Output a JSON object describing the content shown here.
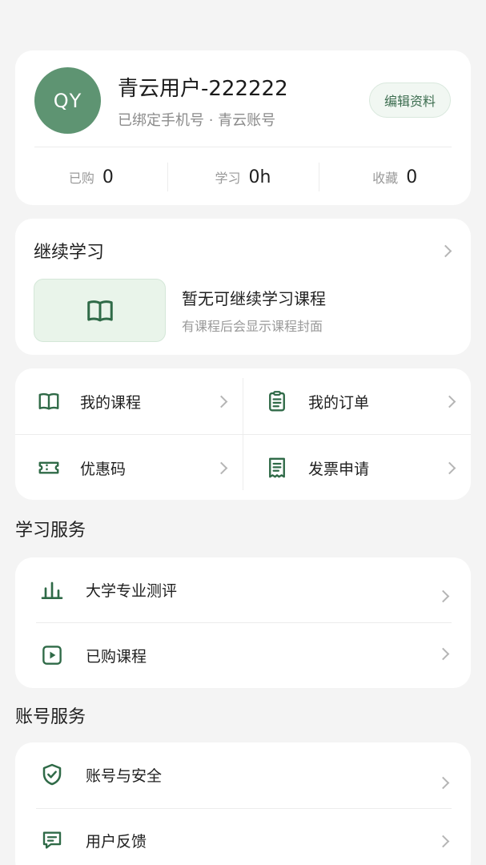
{
  "profile": {
    "avatar_initials": "QY",
    "name": "青云用户-222222",
    "subtitle": "已绑定手机号 · 青云账号",
    "edit_label": "编辑资料",
    "stats": [
      {
        "label": "已购",
        "value": "0"
      },
      {
        "label": "学习",
        "value": "0h"
      },
      {
        "label": "收藏",
        "value": "0"
      }
    ]
  },
  "continue_learning": {
    "title": "继续学习",
    "empty_title": "暂无可继续学习课程",
    "empty_subtitle": "有课程后会显示课程封面",
    "thumb_icon": "open-book-icon"
  },
  "quick_actions": [
    {
      "label": "我的课程",
      "icon": "open-book-icon"
    },
    {
      "label": "我的订单",
      "icon": "clipboard-icon"
    },
    {
      "label": "优惠码",
      "icon": "coupon-ticket-icon"
    },
    {
      "label": "发票申请",
      "icon": "receipt-icon"
    }
  ],
  "study_services": {
    "title": "学习服务",
    "items": [
      {
        "label": "大学专业测评",
        "icon": "bar-chart-icon"
      },
      {
        "label": "已购课程",
        "icon": "play-square-icon"
      }
    ]
  },
  "account_services": {
    "title": "账号服务",
    "items": [
      {
        "label": "账号与安全",
        "icon": "shield-check-icon"
      },
      {
        "label": "用户反馈",
        "icon": "feedback-message-icon"
      }
    ]
  },
  "colors": {
    "accent": "#2f6a47",
    "avatar_bg": "#5e9472",
    "thumb_bg": "#e9f4ea",
    "background": "#f4f4f4"
  }
}
